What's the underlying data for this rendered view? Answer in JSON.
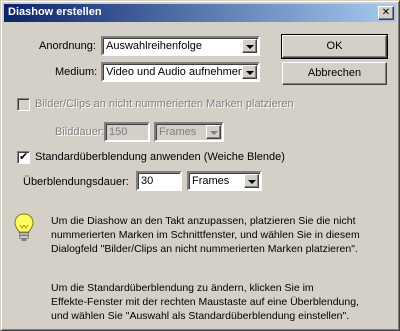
{
  "window": {
    "title": "Diashow erstellen",
    "close_glyph": "✕"
  },
  "anordnung": {
    "label": "Anordnung:",
    "value": "Auswahlreihenfolge"
  },
  "medium": {
    "label": "Medium:",
    "value": "Video und Audio aufnehmen"
  },
  "buttons": {
    "ok": "OK",
    "cancel": "Abbrechen"
  },
  "place_unnumbered": {
    "label": "Bilder/Clips an nicht nummerierten Marken platzieren",
    "checked": false,
    "enabled": false
  },
  "bilddauer": {
    "label": "Bilddauer:",
    "value": "150",
    "unit": "Frames"
  },
  "default_transition": {
    "label": "Standardüberblendung anwenden (Weiche Blende)",
    "checked": true,
    "check_glyph": "✔"
  },
  "transition_duration": {
    "label": "Überblendungsdauer:",
    "value": "30",
    "unit": "Frames"
  },
  "hints": {
    "icon": "lightbulb-icon",
    "tip1_line1": "Um die Diashow an den Takt anzupassen, platzieren Sie die nicht",
    "tip1_line2": "nummerierten Marken im Schnittfenster, und wählen Sie in diesem",
    "tip1_line3": "Dialogfeld \"Bilder/Clips an nicht nummerierten Marken platzieren\".",
    "tip2_line1": "Um die Standardüberblendung zu ändern, klicken Sie im",
    "tip2_line2": "Effekte-Fenster mit der rechten Maustaste auf eine Überblendung,",
    "tip2_line3": "und wählen Sie \"Auswahl als Standardüberblendung einstellen\"."
  },
  "colors": {
    "face": "#d4d0c8",
    "title_start": "#0a246a",
    "title_end": "#a6caf0",
    "disabled_text": "#808080"
  }
}
